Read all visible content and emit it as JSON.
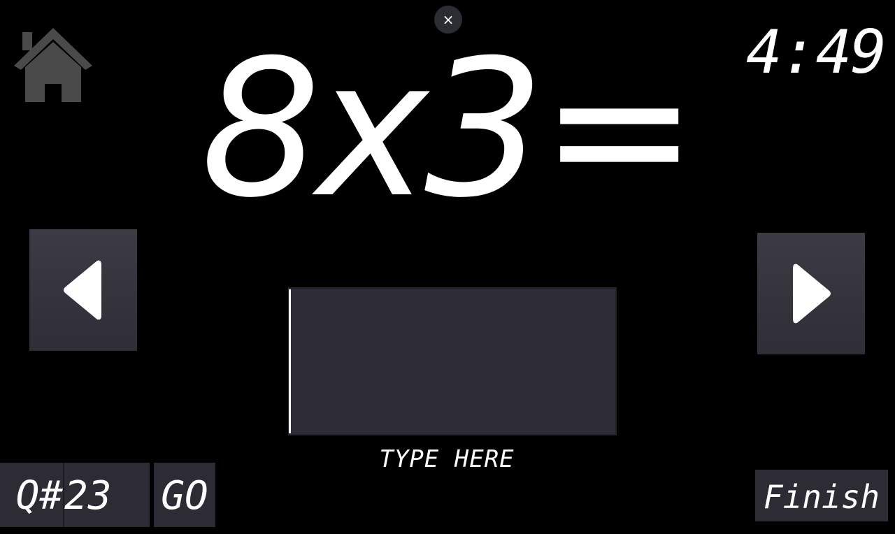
{
  "header": {
    "close_label": "×",
    "close_icon": "close-icon",
    "home_icon": "home-icon",
    "timer": "4:49"
  },
  "problem": {
    "text": "8x3="
  },
  "nav": {
    "prev_icon": "triangle-left-icon",
    "next_icon": "triangle-right-icon"
  },
  "answer": {
    "value": "",
    "hint": "TYPE HERE"
  },
  "footer": {
    "question_label": "Q#",
    "question_number": "23",
    "go_label": "GO",
    "finish_label": "Finish"
  },
  "colors": {
    "background": "#000000",
    "panel": "#2e2c36",
    "home_icon": "#4a4a4a",
    "text": "#ffffff"
  }
}
